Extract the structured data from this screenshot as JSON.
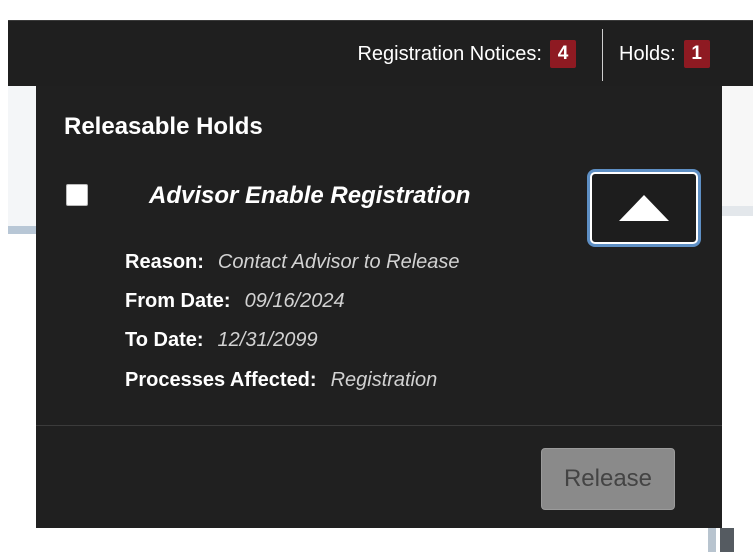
{
  "header": {
    "registration_notices_label": "Registration Notices:",
    "registration_notices_count": "4",
    "holds_label": "Holds:",
    "holds_count": "1"
  },
  "panel": {
    "title": "Releasable Holds",
    "hold": {
      "name": "Advisor Enable Registration",
      "checked": false,
      "expanded": true,
      "toggle_icon": "triangle-up-icon",
      "details": [
        {
          "label": "Reason:",
          "value": "Contact Advisor to Release"
        },
        {
          "label": "From Date:",
          "value": "09/16/2024"
        },
        {
          "label": "To Date:",
          "value": "12/31/2099"
        },
        {
          "label": "Processes Affected:",
          "value": "Registration"
        }
      ]
    },
    "release_button": "Release"
  },
  "colors": {
    "badge": "#8e1a22",
    "panel_bg": "#202020",
    "focus_ring": "#5e8fc4"
  }
}
